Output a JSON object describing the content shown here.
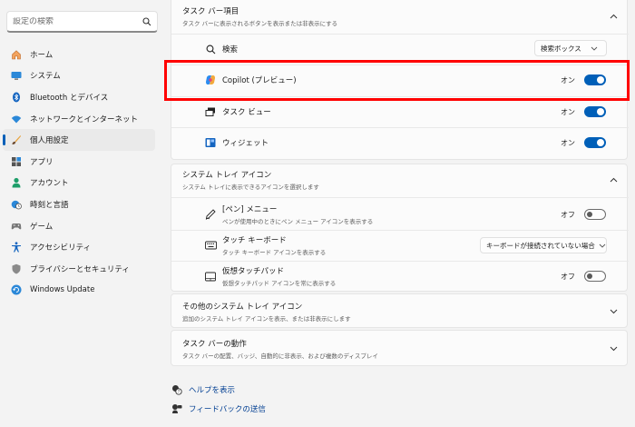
{
  "search": {
    "placeholder": "設定の検索"
  },
  "sidebar": {
    "items": [
      {
        "label": "ホーム",
        "icon": "home-icon"
      },
      {
        "label": "システム",
        "icon": "monitor-icon"
      },
      {
        "label": "Bluetooth とデバイス",
        "icon": "bluetooth-icon"
      },
      {
        "label": "ネットワークとインターネット",
        "icon": "wifi-icon"
      },
      {
        "label": "個人用設定",
        "icon": "brush-icon",
        "active": true
      },
      {
        "label": "アプリ",
        "icon": "apps-icon"
      },
      {
        "label": "アカウント",
        "icon": "person-icon"
      },
      {
        "label": "時刻と言語",
        "icon": "clock-globe-icon"
      },
      {
        "label": "ゲーム",
        "icon": "gamepad-icon"
      },
      {
        "label": "アクセシビリティ",
        "icon": "accessibility-icon"
      },
      {
        "label": "プライバシーとセキュリティ",
        "icon": "shield-icon"
      },
      {
        "label": "Windows Update",
        "icon": "update-icon"
      }
    ]
  },
  "taskbar_items": {
    "title": "タスク バー項目",
    "subtitle": "タスク バーに表示されるボタンを表示または非表示にする",
    "search": {
      "label": "検索",
      "value": "検索ボックス"
    },
    "copilot": {
      "label": "Copilot (プレビュー)",
      "state": "オン"
    },
    "taskview": {
      "label": "タスク ビュー",
      "state": "オン"
    },
    "widgets": {
      "label": "ウィジェット",
      "state": "オン"
    }
  },
  "system_tray": {
    "title": "システム トレイ アイコン",
    "subtitle": "システム トレイに表示できるアイコンを選択します",
    "pen": {
      "label": "[ペン] メニュー",
      "sub": "ペンが使用中のときにペン メニュー アイコンを表示する",
      "state": "オフ"
    },
    "touch_keyboard": {
      "label": "タッチ キーボード",
      "sub": "タッチ キーボード アイコンを表示する",
      "value": "キーボードが接続されていない場合"
    },
    "touchpad": {
      "label": "仮想タッチパッド",
      "sub": "仮想タッチパッド アイコンを常に表示する",
      "state": "オフ"
    }
  },
  "other_tray": {
    "title": "その他のシステム トレイ アイコン",
    "subtitle": "追加のシステム トレイ アイコンを表示、または非表示にします"
  },
  "behaviors": {
    "title": "タスク バーの動作",
    "subtitle": "タスク バーの配置、バッジ、自動的に非表示、および複数のディスプレイ"
  },
  "links": {
    "help": "ヘルプを表示",
    "feedback": "フィードバックの送信"
  },
  "colors": {
    "accent": "#005fb8",
    "highlight": "#ff0000"
  }
}
